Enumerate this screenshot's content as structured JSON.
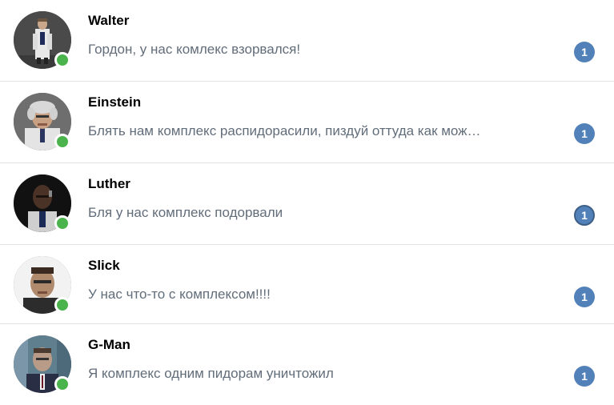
{
  "dialogs": [
    {
      "name": "Walter",
      "message": "Гордон, у нас комлекс взорвался!",
      "unread": "1",
      "online": true
    },
    {
      "name": "Einstein",
      "message": "Блять нам комплекс распидорасили, пиздуй оттуда как мож…",
      "unread": "1",
      "online": true
    },
    {
      "name": "Luther",
      "message": "Бля у нас комплекс подорвали",
      "unread": "1",
      "online": true
    },
    {
      "name": "Slick",
      "message": "У нас что-то с комплексом!!!!",
      "unread": "1",
      "online": true
    },
    {
      "name": "G-Man",
      "message": "Я комплекс одним пидорам уничтожил",
      "unread": "1",
      "online": true
    }
  ],
  "colors": {
    "badge": "#5181b8",
    "online": "#4bb34b",
    "message_text": "#626d7a",
    "separator": "#e1e3e6"
  },
  "icons": {
    "online": "online-indicator-dot"
  }
}
